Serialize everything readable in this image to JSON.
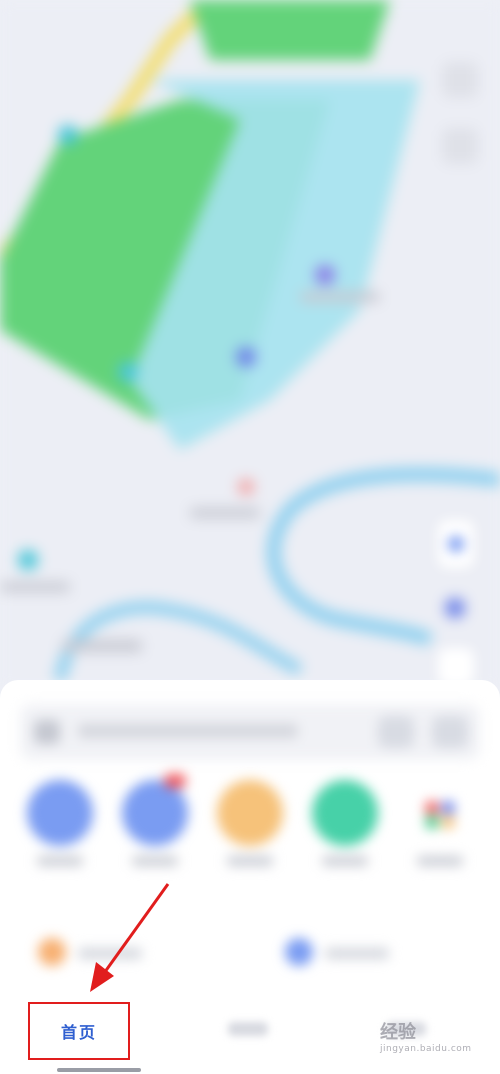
{
  "tabbar": {
    "home_label": "首页"
  },
  "watermark": {
    "text": "经验",
    "sub": "jingyan.baidu.com"
  },
  "colors": {
    "accent": "#2f5fd0",
    "annotation": "#e11d1d",
    "park_green": "#63d37a",
    "river_blue": "#8fd0ef",
    "quick_blue": "#7a9cf2",
    "quick_orange": "#f6c27a",
    "quick_teal": "#47d1a8"
  },
  "icons": {
    "quick_actions": [
      "quick-action-icon-1",
      "quick-action-icon-2",
      "quick-action-icon-3",
      "quick-action-icon-4",
      "quick-action-icon-5"
    ],
    "annotation": "red-arrow-icon"
  }
}
